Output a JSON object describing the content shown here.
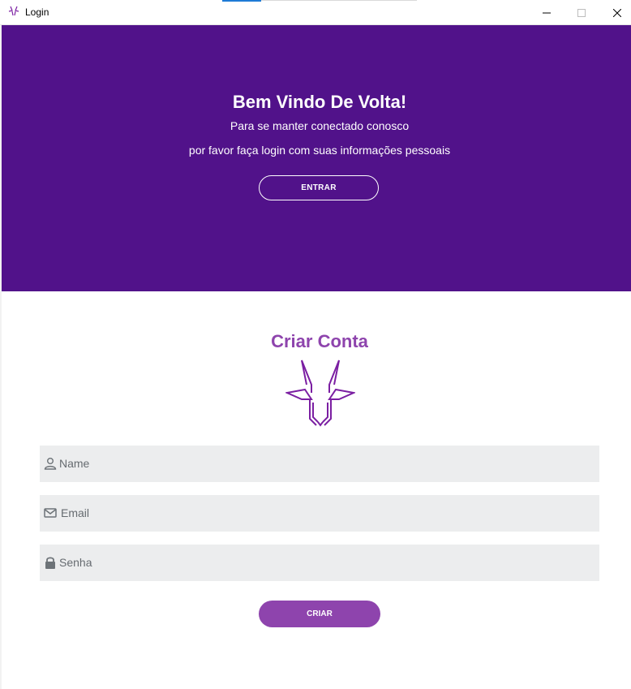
{
  "window": {
    "title": "Login"
  },
  "hero": {
    "title": "Bem Vindo De Volta!",
    "line1": "Para se manter conectado conosco",
    "line2": "por favor faça login com suas informações pessoais",
    "button_label": "ENTRAR",
    "background": "#51128a"
  },
  "form": {
    "title": "Criar Conta",
    "fields": [
      {
        "placeholder": "Name",
        "icon": "user-icon"
      },
      {
        "placeholder": "Email",
        "icon": "envelope-icon"
      },
      {
        "placeholder": "Senha",
        "icon": "lock-icon"
      }
    ],
    "submit_label": "CRIAR",
    "accent": "#8e44ad"
  }
}
